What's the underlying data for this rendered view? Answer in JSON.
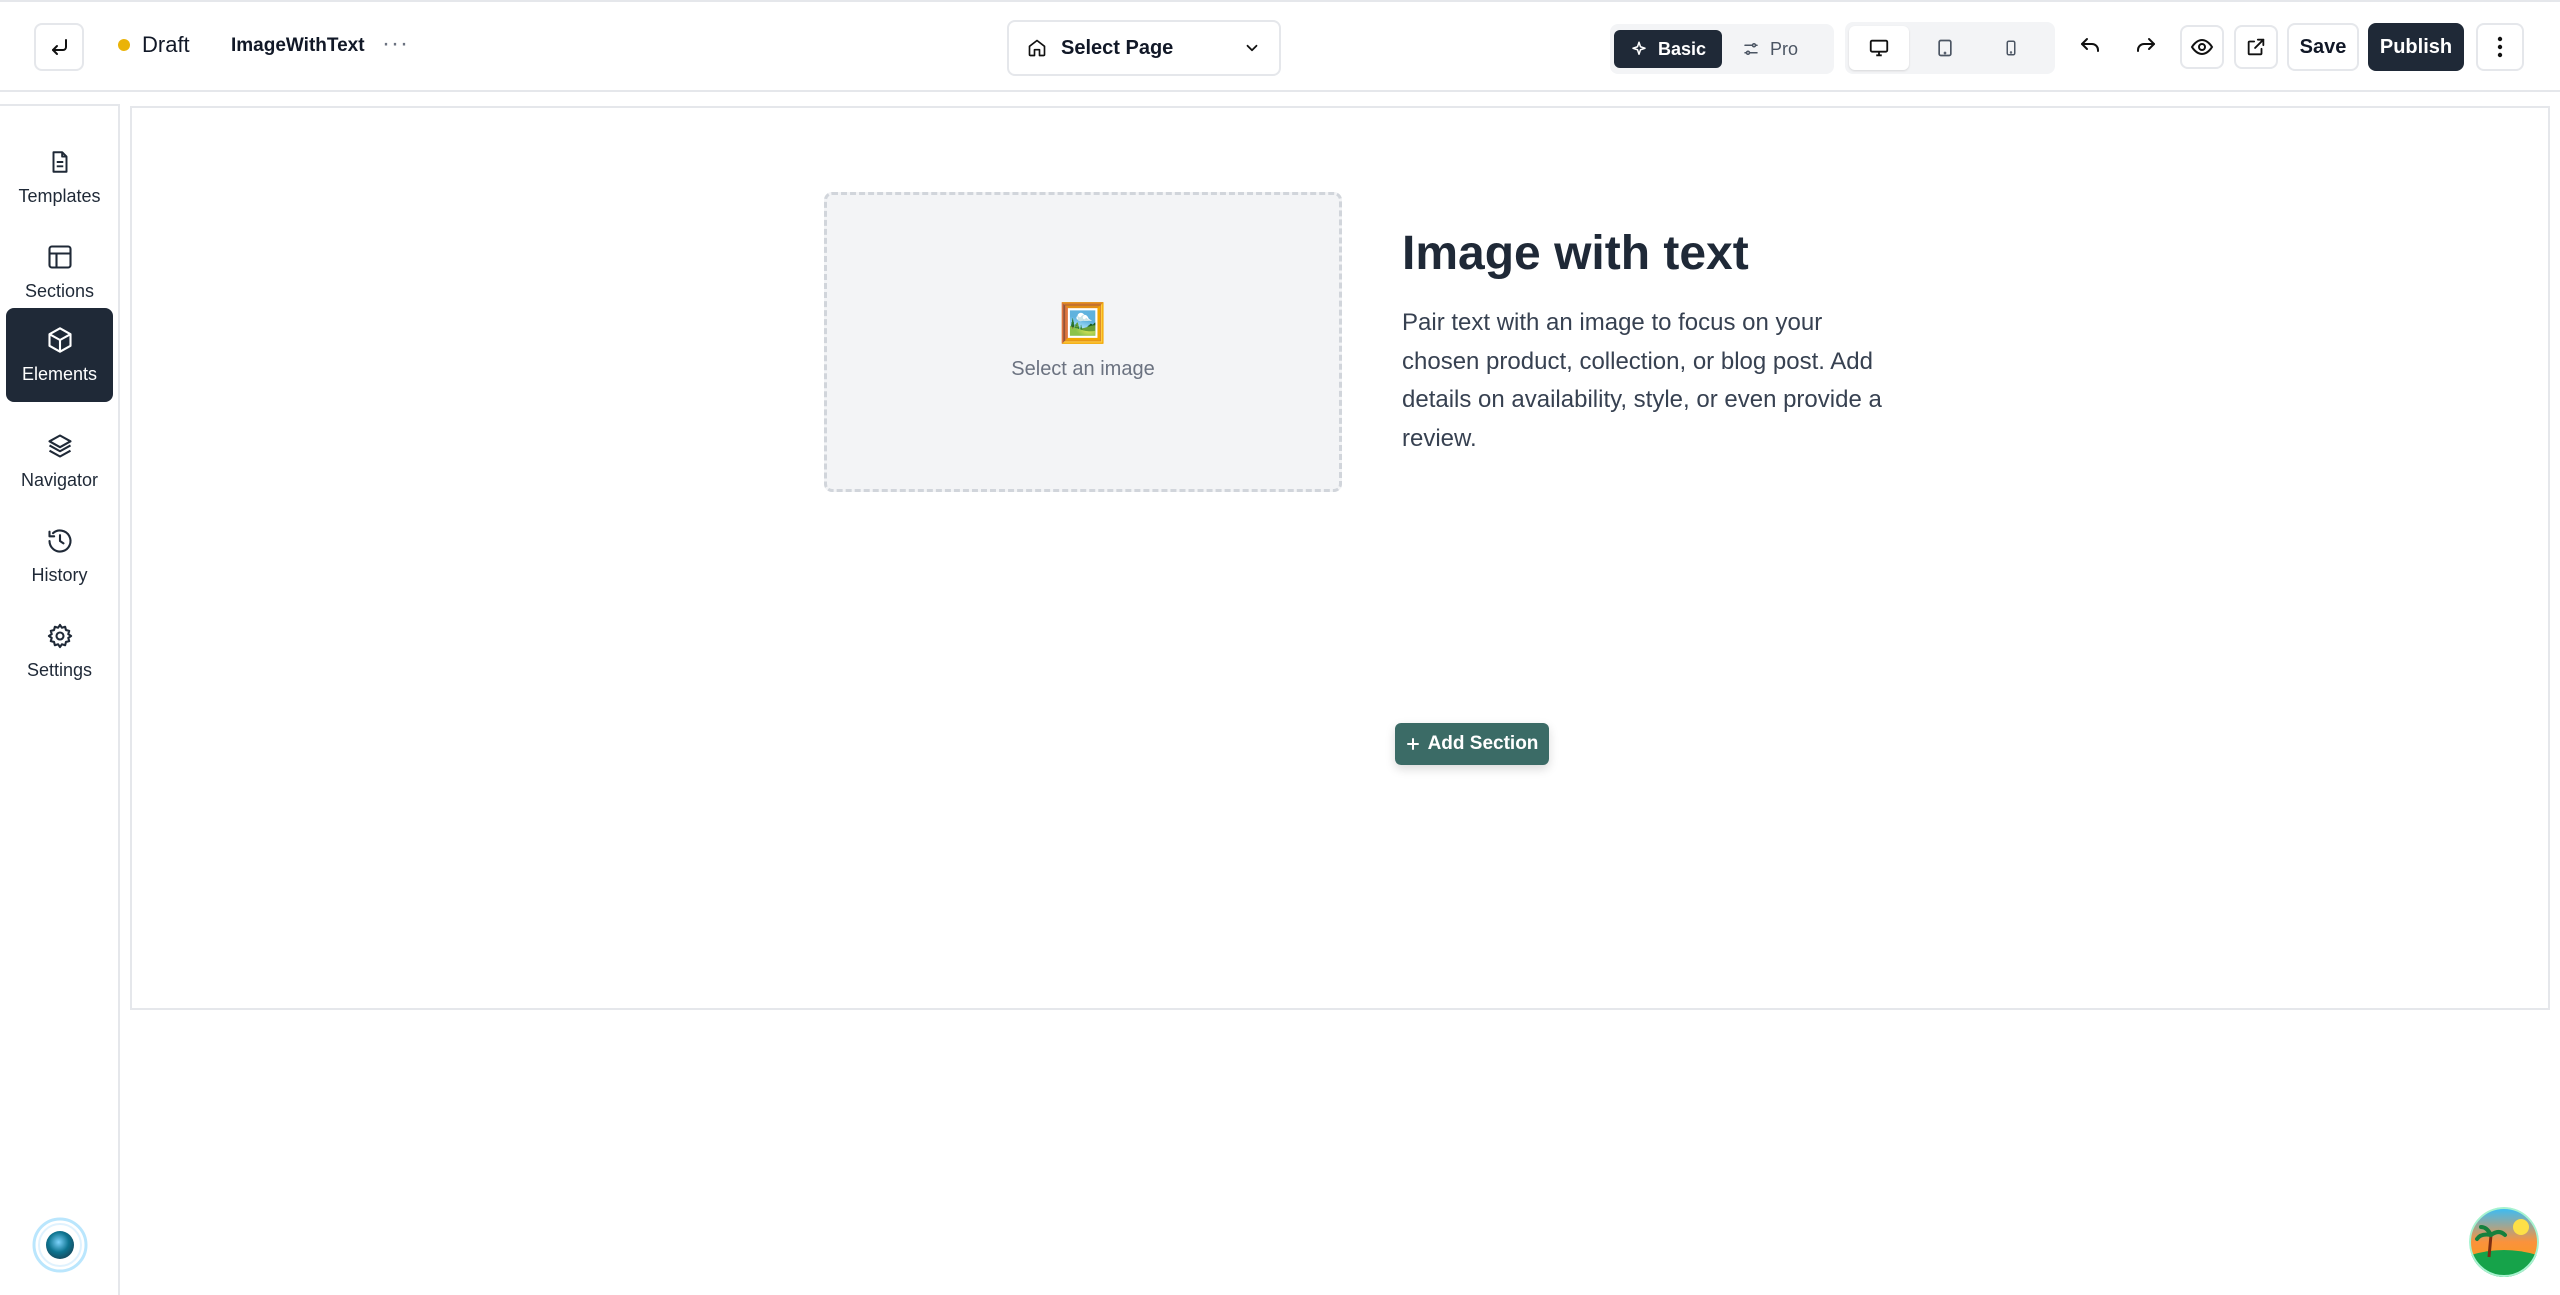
{
  "topbar": {
    "status": {
      "text": "Draft",
      "color": "#eab308"
    },
    "page_name": "ImageWithText",
    "more_glyph": "···",
    "page_select": {
      "label": "Select Page",
      "icon": "home-icon"
    },
    "modes": [
      {
        "label": "Basic",
        "icon": "sparkle-icon",
        "active": true
      },
      {
        "label": "Pro",
        "icon": "sliders-icon",
        "active": false
      }
    ],
    "devices": [
      {
        "name": "desktop",
        "icon": "monitor-icon",
        "active": true
      },
      {
        "name": "tablet",
        "icon": "tablet-icon",
        "active": false
      },
      {
        "name": "mobile",
        "icon": "phone-icon",
        "active": false
      }
    ],
    "save_label": "Save",
    "publish_label": "Publish"
  },
  "sidebar": {
    "items": [
      {
        "label": "Templates",
        "icon": "document-icon",
        "active": false
      },
      {
        "label": "Sections",
        "icon": "layout-icon",
        "active": false
      },
      {
        "label": "Elements",
        "icon": "cube-icon",
        "active": true
      },
      {
        "label": "Navigator",
        "icon": "layers-icon",
        "active": false
      },
      {
        "label": "History",
        "icon": "history-icon",
        "active": false
      },
      {
        "label": "Settings",
        "icon": "gear-icon",
        "active": false
      }
    ]
  },
  "canvas": {
    "image_placeholder": {
      "emoji": "🖼️",
      "text": "Select an image"
    },
    "heading": "Image with text",
    "body": "Pair text with an image to focus on your chosen product, collection, or blog post. Add details on availability, style, or even provide a review.",
    "add_section_label": "Add Section"
  },
  "colors": {
    "accent_dark": "#1f2937",
    "add_section_bg": "#3b6b66",
    "draft_dot": "#eab308"
  }
}
